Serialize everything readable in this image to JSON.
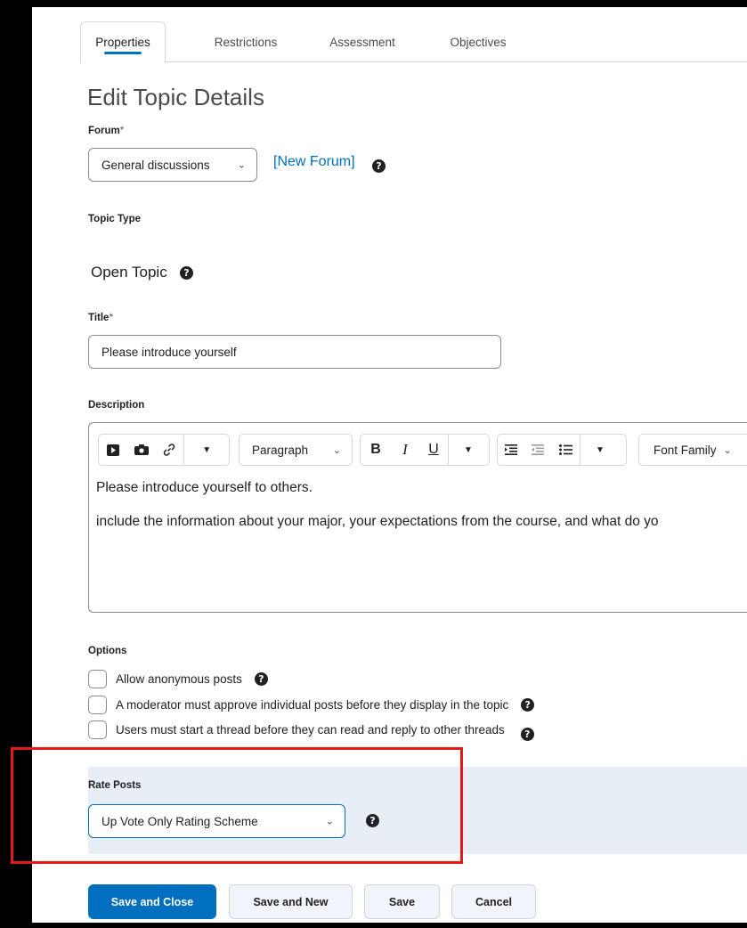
{
  "tabs": [
    {
      "label": "Properties",
      "active": true
    },
    {
      "label": "Restrictions",
      "active": false
    },
    {
      "label": "Assessment",
      "active": false
    },
    {
      "label": "Objectives",
      "active": false
    }
  ],
  "page_title": "Edit Topic Details",
  "forum": {
    "label": "Forum",
    "required_marker": "*",
    "selected": "General discussions",
    "new_forum_link": "[New Forum]"
  },
  "topic_type": {
    "label": "Topic Type",
    "value": "Open Topic"
  },
  "title_field": {
    "label": "Title",
    "required_marker": "*",
    "value": "Please introduce yourself"
  },
  "description": {
    "label": "Description",
    "toolbar": {
      "paragraph_select": "Paragraph",
      "bold": "B",
      "italic": "I",
      "underline": "U",
      "font_family_select": "Font Family"
    },
    "body": [
      "Please introduce yourself to others.",
      "include the information about your major, your expectations from the course, and what do yo"
    ]
  },
  "options": {
    "label": "Options",
    "items": [
      {
        "label": "Allow anonymous posts",
        "checked": false
      },
      {
        "label": "A moderator must approve individual posts before they display in the topic",
        "checked": false
      },
      {
        "label": "Users must start a thread before they can read and reply to other threads",
        "checked": false
      }
    ]
  },
  "rate_posts": {
    "label": "Rate Posts",
    "selected": "Up Vote Only Rating Scheme"
  },
  "buttons": {
    "save_and_close": "Save and Close",
    "save_and_new": "Save and New",
    "save": "Save",
    "cancel": "Cancel"
  },
  "colors": {
    "primary": "#006fbf",
    "highlight_box": "#e31b14",
    "rate_panel_bg": "#e8eef6"
  }
}
